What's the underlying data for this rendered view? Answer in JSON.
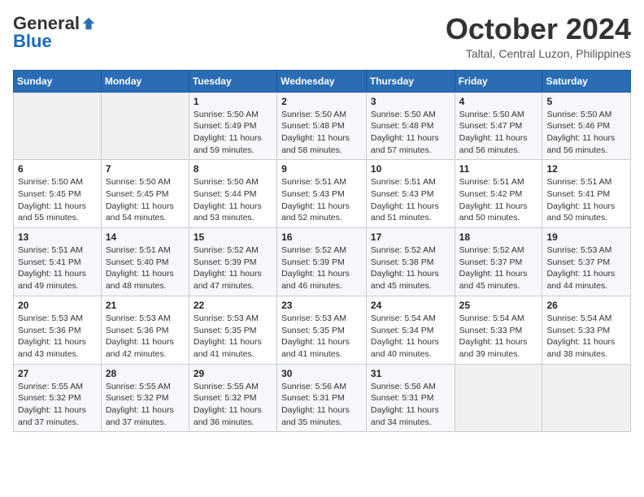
{
  "header": {
    "logo_general": "General",
    "logo_blue": "Blue",
    "month": "October 2024",
    "location": "Taltal, Central Luzon, Philippines"
  },
  "weekdays": [
    "Sunday",
    "Monday",
    "Tuesday",
    "Wednesday",
    "Thursday",
    "Friday",
    "Saturday"
  ],
  "weeks": [
    [
      {
        "day": "",
        "info": ""
      },
      {
        "day": "",
        "info": ""
      },
      {
        "day": "1",
        "info": "Sunrise: 5:50 AM\nSunset: 5:49 PM\nDaylight: 11 hours and 59 minutes."
      },
      {
        "day": "2",
        "info": "Sunrise: 5:50 AM\nSunset: 5:48 PM\nDaylight: 11 hours and 58 minutes."
      },
      {
        "day": "3",
        "info": "Sunrise: 5:50 AM\nSunset: 5:48 PM\nDaylight: 11 hours and 57 minutes."
      },
      {
        "day": "4",
        "info": "Sunrise: 5:50 AM\nSunset: 5:47 PM\nDaylight: 11 hours and 56 minutes."
      },
      {
        "day": "5",
        "info": "Sunrise: 5:50 AM\nSunset: 5:46 PM\nDaylight: 11 hours and 56 minutes."
      }
    ],
    [
      {
        "day": "6",
        "info": "Sunrise: 5:50 AM\nSunset: 5:45 PM\nDaylight: 11 hours and 55 minutes."
      },
      {
        "day": "7",
        "info": "Sunrise: 5:50 AM\nSunset: 5:45 PM\nDaylight: 11 hours and 54 minutes."
      },
      {
        "day": "8",
        "info": "Sunrise: 5:50 AM\nSunset: 5:44 PM\nDaylight: 11 hours and 53 minutes."
      },
      {
        "day": "9",
        "info": "Sunrise: 5:51 AM\nSunset: 5:43 PM\nDaylight: 11 hours and 52 minutes."
      },
      {
        "day": "10",
        "info": "Sunrise: 5:51 AM\nSunset: 5:43 PM\nDaylight: 11 hours and 51 minutes."
      },
      {
        "day": "11",
        "info": "Sunrise: 5:51 AM\nSunset: 5:42 PM\nDaylight: 11 hours and 50 minutes."
      },
      {
        "day": "12",
        "info": "Sunrise: 5:51 AM\nSunset: 5:41 PM\nDaylight: 11 hours and 50 minutes."
      }
    ],
    [
      {
        "day": "13",
        "info": "Sunrise: 5:51 AM\nSunset: 5:41 PM\nDaylight: 11 hours and 49 minutes."
      },
      {
        "day": "14",
        "info": "Sunrise: 5:51 AM\nSunset: 5:40 PM\nDaylight: 11 hours and 48 minutes."
      },
      {
        "day": "15",
        "info": "Sunrise: 5:52 AM\nSunset: 5:39 PM\nDaylight: 11 hours and 47 minutes."
      },
      {
        "day": "16",
        "info": "Sunrise: 5:52 AM\nSunset: 5:39 PM\nDaylight: 11 hours and 46 minutes."
      },
      {
        "day": "17",
        "info": "Sunrise: 5:52 AM\nSunset: 5:38 PM\nDaylight: 11 hours and 45 minutes."
      },
      {
        "day": "18",
        "info": "Sunrise: 5:52 AM\nSunset: 5:37 PM\nDaylight: 11 hours and 45 minutes."
      },
      {
        "day": "19",
        "info": "Sunrise: 5:53 AM\nSunset: 5:37 PM\nDaylight: 11 hours and 44 minutes."
      }
    ],
    [
      {
        "day": "20",
        "info": "Sunrise: 5:53 AM\nSunset: 5:36 PM\nDaylight: 11 hours and 43 minutes."
      },
      {
        "day": "21",
        "info": "Sunrise: 5:53 AM\nSunset: 5:36 PM\nDaylight: 11 hours and 42 minutes."
      },
      {
        "day": "22",
        "info": "Sunrise: 5:53 AM\nSunset: 5:35 PM\nDaylight: 11 hours and 41 minutes."
      },
      {
        "day": "23",
        "info": "Sunrise: 5:53 AM\nSunset: 5:35 PM\nDaylight: 11 hours and 41 minutes."
      },
      {
        "day": "24",
        "info": "Sunrise: 5:54 AM\nSunset: 5:34 PM\nDaylight: 11 hours and 40 minutes."
      },
      {
        "day": "25",
        "info": "Sunrise: 5:54 AM\nSunset: 5:33 PM\nDaylight: 11 hours and 39 minutes."
      },
      {
        "day": "26",
        "info": "Sunrise: 5:54 AM\nSunset: 5:33 PM\nDaylight: 11 hours and 38 minutes."
      }
    ],
    [
      {
        "day": "27",
        "info": "Sunrise: 5:55 AM\nSunset: 5:32 PM\nDaylight: 11 hours and 37 minutes."
      },
      {
        "day": "28",
        "info": "Sunrise: 5:55 AM\nSunset: 5:32 PM\nDaylight: 11 hours and 37 minutes."
      },
      {
        "day": "29",
        "info": "Sunrise: 5:55 AM\nSunset: 5:32 PM\nDaylight: 11 hours and 36 minutes."
      },
      {
        "day": "30",
        "info": "Sunrise: 5:56 AM\nSunset: 5:31 PM\nDaylight: 11 hours and 35 minutes."
      },
      {
        "day": "31",
        "info": "Sunrise: 5:56 AM\nSunset: 5:31 PM\nDaylight: 11 hours and 34 minutes."
      },
      {
        "day": "",
        "info": ""
      },
      {
        "day": "",
        "info": ""
      }
    ]
  ]
}
